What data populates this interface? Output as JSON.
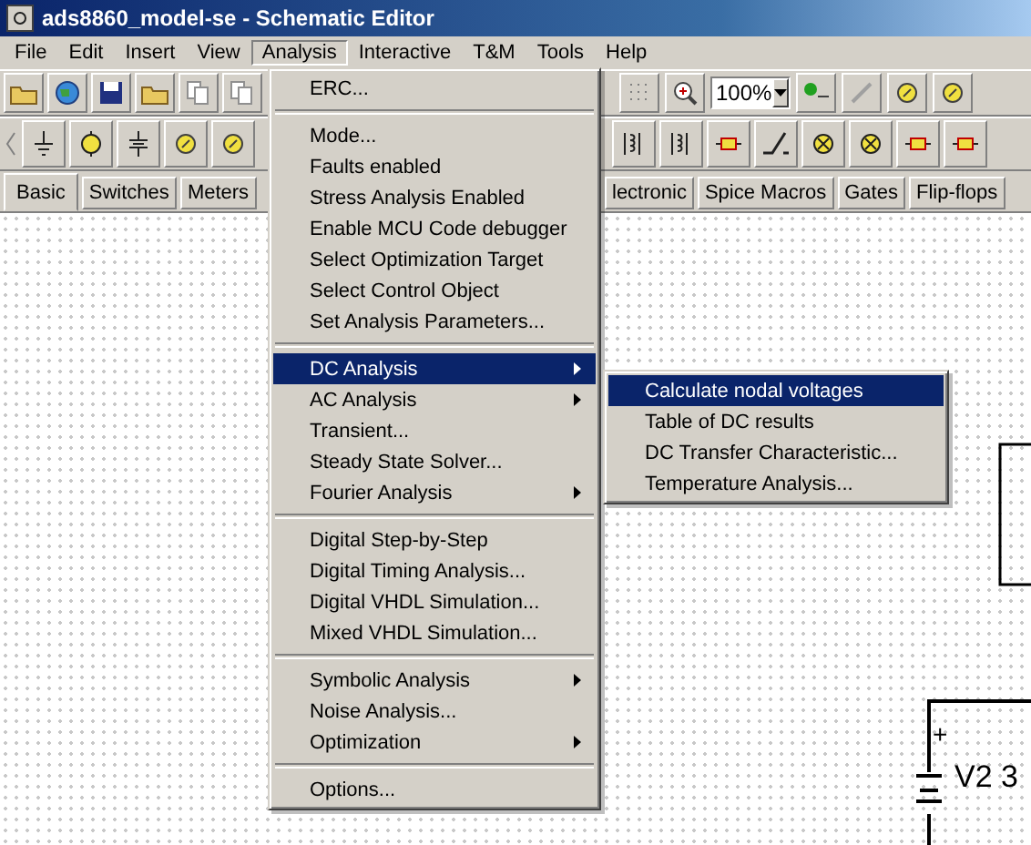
{
  "window": {
    "title": "ads8860_model-se - Schematic Editor"
  },
  "menubar": [
    {
      "label": "File",
      "selected": false
    },
    {
      "label": "Edit",
      "selected": false
    },
    {
      "label": "Insert",
      "selected": false
    },
    {
      "label": "View",
      "selected": false
    },
    {
      "label": "Analysis",
      "selected": true
    },
    {
      "label": "Interactive",
      "selected": false
    },
    {
      "label": "T&M",
      "selected": false
    },
    {
      "label": "Tools",
      "selected": false
    },
    {
      "label": "Help",
      "selected": false
    }
  ],
  "toolbar": {
    "zoom": "100%"
  },
  "component_tabs": [
    {
      "label": "Basic",
      "selected": true
    },
    {
      "label": "Switches",
      "selected": false
    },
    {
      "label": "Meters",
      "selected": false
    },
    {
      "label": "lectronic",
      "selected": false
    },
    {
      "label": "Spice Macros",
      "selected": false
    },
    {
      "label": "Gates",
      "selected": false
    },
    {
      "label": "Flip-flops",
      "selected": false
    }
  ],
  "analysis_menu": [
    {
      "kind": "item",
      "label": "ERC...",
      "submenu": false,
      "selected": false
    },
    {
      "kind": "separator"
    },
    {
      "kind": "item",
      "label": "Mode...",
      "submenu": false,
      "selected": false
    },
    {
      "kind": "item",
      "label": "Faults enabled",
      "submenu": false,
      "selected": false
    },
    {
      "kind": "item",
      "label": "Stress Analysis Enabled",
      "submenu": false,
      "selected": false
    },
    {
      "kind": "item",
      "label": "Enable MCU Code debugger",
      "submenu": false,
      "selected": false
    },
    {
      "kind": "item",
      "label": "Select Optimization Target",
      "submenu": false,
      "selected": false
    },
    {
      "kind": "item",
      "label": "Select Control Object",
      "submenu": false,
      "selected": false
    },
    {
      "kind": "item",
      "label": "Set Analysis Parameters...",
      "submenu": false,
      "selected": false
    },
    {
      "kind": "separator"
    },
    {
      "kind": "item",
      "label": "DC Analysis",
      "submenu": true,
      "selected": true
    },
    {
      "kind": "item",
      "label": "AC Analysis",
      "submenu": true,
      "selected": false
    },
    {
      "kind": "item",
      "label": "Transient...",
      "submenu": false,
      "selected": false
    },
    {
      "kind": "item",
      "label": "Steady State Solver...",
      "submenu": false,
      "selected": false
    },
    {
      "kind": "item",
      "label": "Fourier Analysis",
      "submenu": true,
      "selected": false
    },
    {
      "kind": "separator"
    },
    {
      "kind": "item",
      "label": "Digital Step-by-Step",
      "submenu": false,
      "selected": false
    },
    {
      "kind": "item",
      "label": "Digital Timing Analysis...",
      "submenu": false,
      "selected": false
    },
    {
      "kind": "item",
      "label": "Digital VHDL Simulation...",
      "submenu": false,
      "selected": false
    },
    {
      "kind": "item",
      "label": "Mixed VHDL Simulation...",
      "submenu": false,
      "selected": false
    },
    {
      "kind": "separator"
    },
    {
      "kind": "item",
      "label": "Symbolic Analysis",
      "submenu": true,
      "selected": false
    },
    {
      "kind": "item",
      "label": "Noise Analysis...",
      "submenu": false,
      "selected": false
    },
    {
      "kind": "item",
      "label": "Optimization",
      "submenu": true,
      "selected": false
    },
    {
      "kind": "separator"
    },
    {
      "kind": "item",
      "label": "Options...",
      "submenu": false,
      "selected": false
    }
  ],
  "dc_submenu": [
    {
      "label": "Calculate nodal voltages",
      "selected": true
    },
    {
      "label": "Table of DC results",
      "selected": false
    },
    {
      "label": "DC Transfer Characteristic...",
      "selected": false
    },
    {
      "label": "Temperature Analysis...",
      "selected": false
    }
  ],
  "schematic": {
    "source_polarity": "+",
    "source_label": "V2 3"
  }
}
